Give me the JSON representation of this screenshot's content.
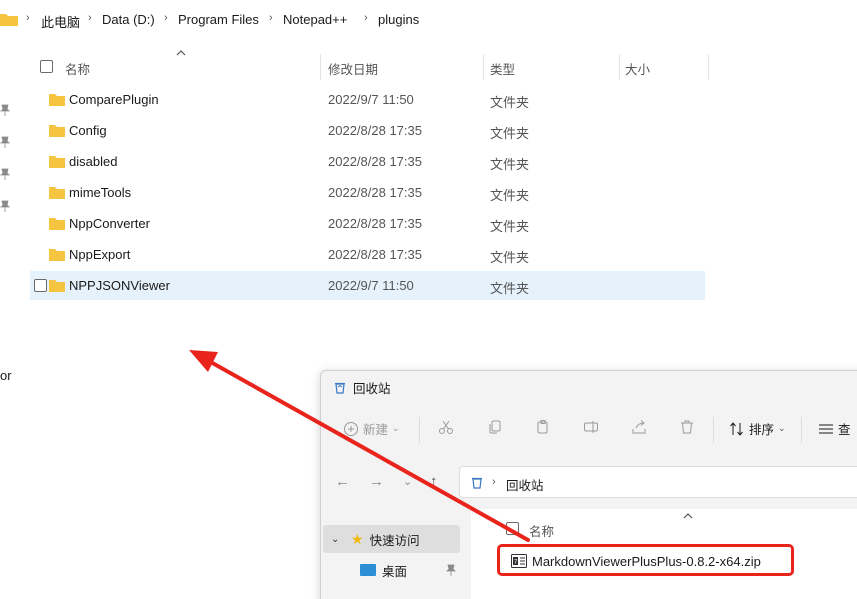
{
  "breadcrumb": {
    "items": [
      "此电脑",
      "Data (D:)",
      "Program Files",
      "Notepad++",
      "plugins"
    ]
  },
  "columns": {
    "name": "名称",
    "modified": "修改日期",
    "type": "类型",
    "size": "大小"
  },
  "files": [
    {
      "name": "ComparePlugin",
      "modified": "2022/9/7 11:50",
      "type": "文件夹"
    },
    {
      "name": "Config",
      "modified": "2022/8/28 17:35",
      "type": "文件夹"
    },
    {
      "name": "disabled",
      "modified": "2022/8/28 17:35",
      "type": "文件夹"
    },
    {
      "name": "mimeTools",
      "modified": "2022/8/28 17:35",
      "type": "文件夹"
    },
    {
      "name": "NppConverter",
      "modified": "2022/8/28 17:35",
      "type": "文件夹"
    },
    {
      "name": "NppExport",
      "modified": "2022/8/28 17:35",
      "type": "文件夹"
    },
    {
      "name": "NPPJSONViewer",
      "modified": "2022/9/7 11:50",
      "type": "文件夹"
    }
  ],
  "nav_fragment": "or",
  "recycle_bin": {
    "title": "回收站",
    "toolbar": {
      "new_label": "新建",
      "sort_label": "排序",
      "view_label": "查"
    },
    "address": "回收站",
    "sidebar": {
      "quick_access": "快速访问",
      "desktop": "桌面"
    },
    "column_name": "名称",
    "items": [
      {
        "name": "MarkdownViewerPlusPlus-0.8.2-x64.zip"
      }
    ]
  },
  "colors": {
    "folder": "#f5c542",
    "selection": "#e5f1fb",
    "annotation": "#e8241c"
  }
}
